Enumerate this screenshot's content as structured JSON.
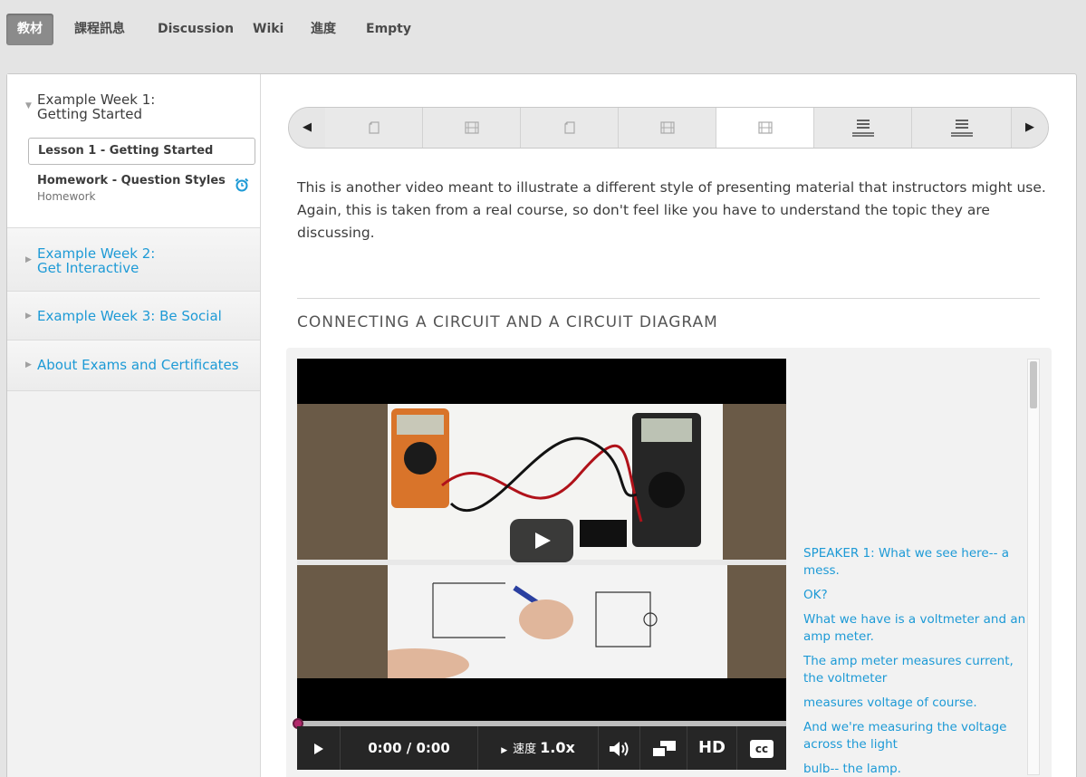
{
  "tabs": [
    {
      "label": "教材",
      "active": true
    },
    {
      "label": "課程訊息",
      "active": false
    },
    {
      "label": "Discussion",
      "active": false
    },
    {
      "label": "Wiki",
      "active": false
    },
    {
      "label": "進度",
      "active": false
    },
    {
      "label": "Empty",
      "active": false
    }
  ],
  "sidebar": {
    "chapters": [
      {
        "title_line1": "Example Week 1:",
        "title_line2": "Getting Started",
        "open": true
      },
      {
        "title_line1": "Example Week 2:",
        "title_line2": "Get Interactive",
        "open": false
      },
      {
        "title": "Example Week 3: Be Social",
        "open": false
      },
      {
        "title": "About Exams and Certificates",
        "open": false
      }
    ],
    "active_lesson": "Lesson 1 - Getting Started",
    "homework_title": "Homework - Question Styles",
    "homework_type": "Homework"
  },
  "sequence": {
    "items": [
      "page-icon",
      "video-icon",
      "page-icon",
      "video-icon",
      "video-icon",
      "list-icon",
      "list-icon"
    ],
    "active_index": 4,
    "prev_symbol": "◀",
    "next_symbol": "▶"
  },
  "content": {
    "intro": "This is another video meant to illustrate a different style of presenting material that instructors might use. Again, this is taken from a real course, so don't feel like you have to understand the topic they are discussing.",
    "video_title": "CONNECTING A CIRCUIT AND A CIRCUIT DIAGRAM"
  },
  "player": {
    "time": "0:00 / 0:00",
    "speed_label": "速度",
    "speed_value": "1.0x",
    "hd_label": "HD",
    "cc_label": "cc",
    "progress": 0
  },
  "transcript": [
    "SPEAKER 1: What we see here-- a mess.",
    "OK?",
    "What we have is a voltmeter and an amp meter.",
    "The amp meter measures current, the voltmeter",
    "measures voltage of course.",
    "And we're measuring the voltage across the light",
    "bulb-- the lamp."
  ],
  "colors": {
    "link": "#1d9ad6",
    "tab_active_bg": "#8b8b8b",
    "progress_dot": "#b2286b"
  }
}
